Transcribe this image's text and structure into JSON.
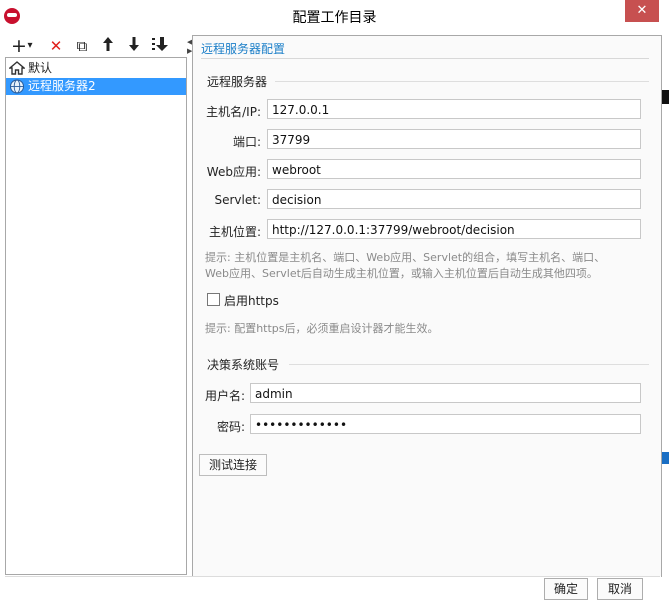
{
  "window": {
    "title": "配置工作目录",
    "close_glyph": "✕"
  },
  "toolbar": {
    "add": "+",
    "add_dropdown": "▾",
    "delete": "✕",
    "copy": "⧉",
    "move_up": "🡑",
    "move_down": "🡓",
    "sort": "↓"
  },
  "tree": {
    "items": [
      {
        "label": "默认",
        "icon": "home-icon"
      },
      {
        "label": "远程服务器2",
        "icon": "globe-icon",
        "selected": true
      }
    ]
  },
  "panel": {
    "title": "远程服务器配置",
    "remote_section": "远程服务器",
    "fields": {
      "host": {
        "label": "主机名/IP:",
        "value": "127.0.0.1"
      },
      "port": {
        "label": "端口:",
        "value": "37799"
      },
      "webapp": {
        "label": "Web应用:",
        "value": "webroot"
      },
      "servlet": {
        "label": "Servlet:",
        "value": "decision"
      },
      "location": {
        "label": "主机位置:",
        "value": "http://127.0.0.1:37799/webroot/decision"
      }
    },
    "hint1_line1": "提示: 主机位置是主机名、端口、Web应用、Servlet的组合，填写主机名、端口、",
    "hint1_line2": "Web应用、Servlet后自动生成主机位置，或输入主机位置后自动生成其他四项。",
    "https_label": "启用https",
    "https_checked": false,
    "hint2": "提示: 配置https后，必须重启设计器才能生效。",
    "account_section": "决策系统账号",
    "username": {
      "label": "用户名:",
      "value": "admin"
    },
    "password": {
      "label": "密码:",
      "value": "•••••••••••••"
    },
    "test_button": "测试连接"
  },
  "footer": {
    "ok": "确定",
    "cancel": "取消"
  },
  "colors": {
    "accent": "#1a7ec8",
    "selection": "#3399ff",
    "close": "#c75050"
  }
}
